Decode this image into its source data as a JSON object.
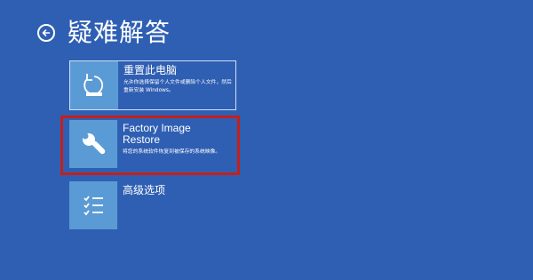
{
  "header": {
    "back_icon": "back-arrow-icon",
    "title": "疑难解答"
  },
  "options": [
    {
      "title": "重置此电脑",
      "description": "允许你选择保留个人文件或删除个人文件，然后重新安装 Windows。",
      "icon": "reset-pc-icon"
    },
    {
      "title": "Factory Image Restore",
      "description": "将您的系统软件恢复到被保存的系统映像。",
      "icon": "wrench-icon"
    },
    {
      "title": "高级选项",
      "description": "",
      "icon": "checklist-icon"
    }
  ],
  "colors": {
    "background": "#2f5fb3",
    "tile": "#5b9bd5",
    "highlight": "#c4201b"
  }
}
